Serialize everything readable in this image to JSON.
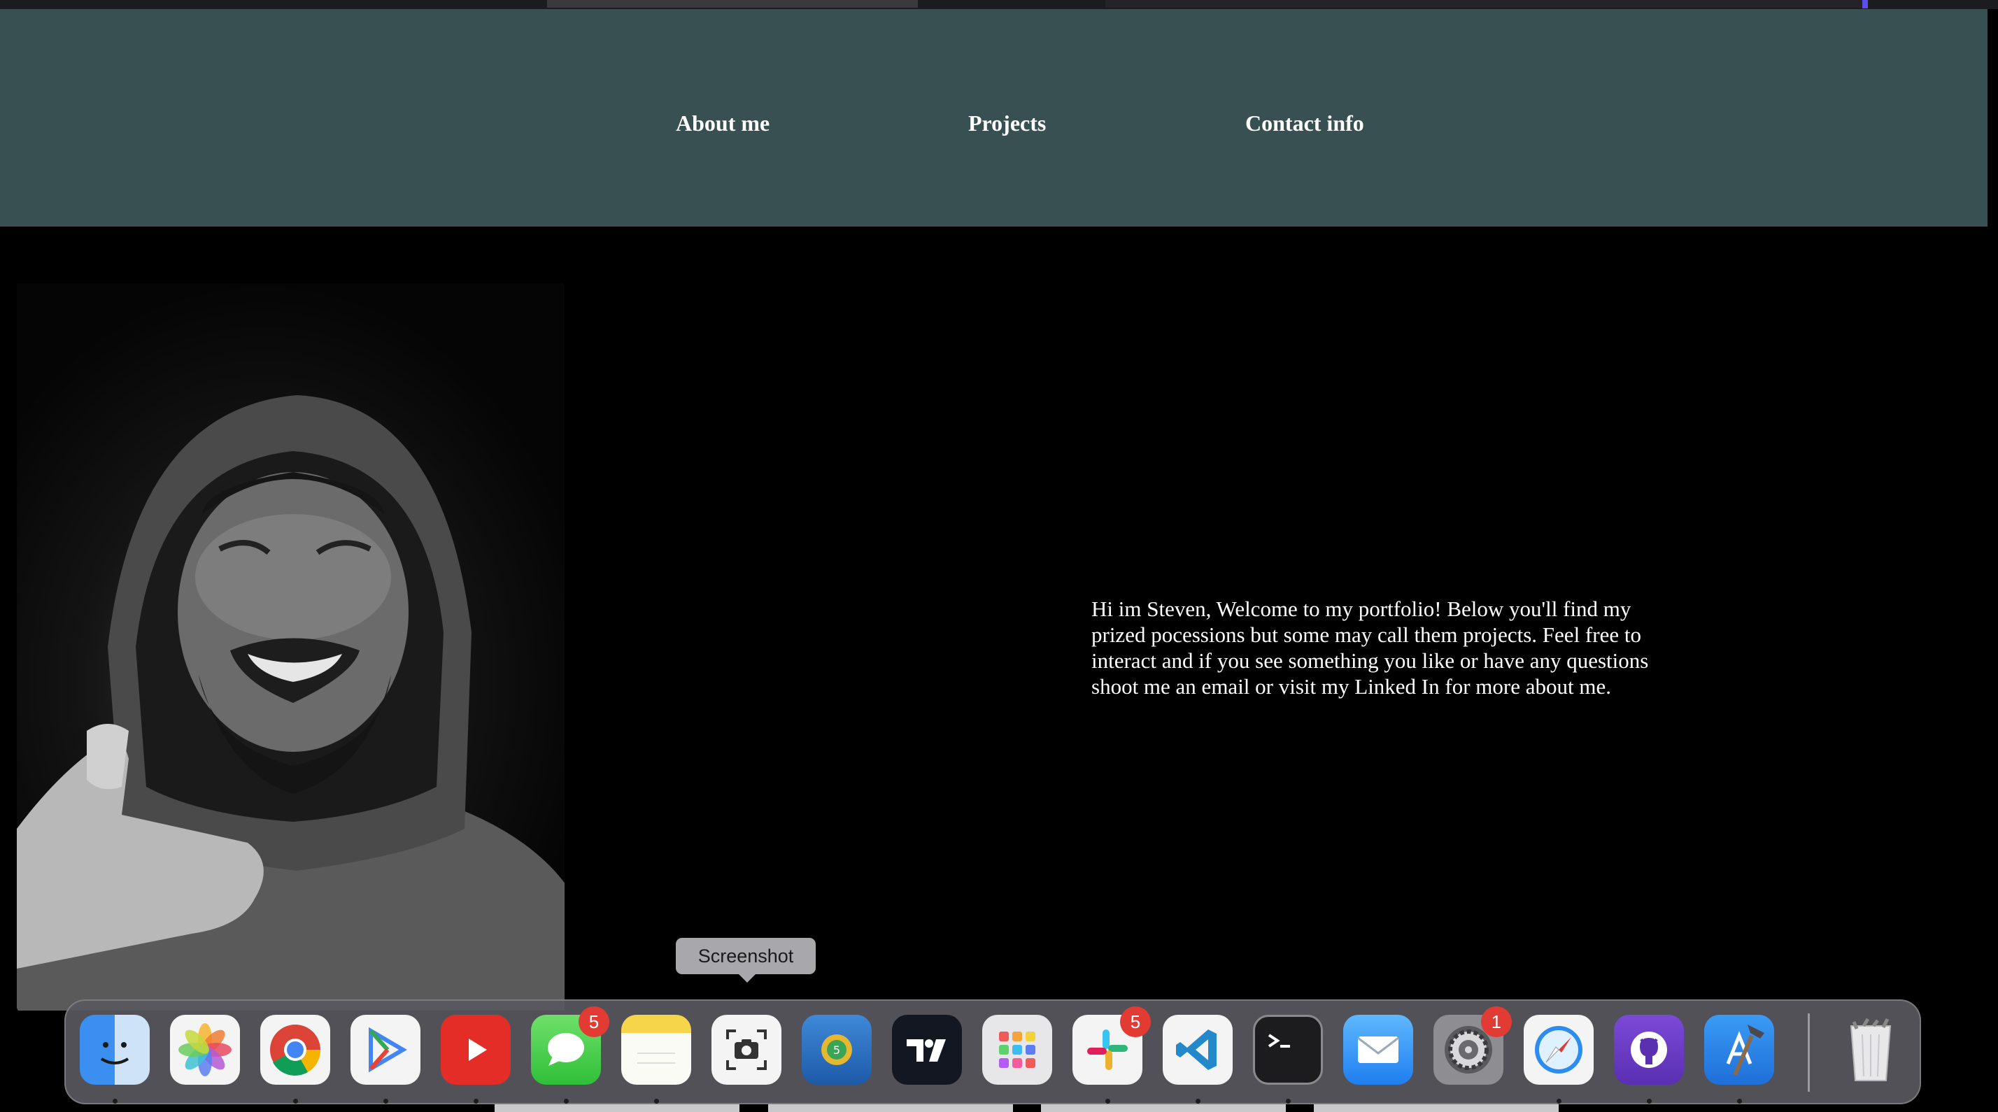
{
  "nav": {
    "about": "About me",
    "projects": "Projects",
    "contact": "Contact info"
  },
  "intro": {
    "text": "Hi im Steven, Welcome to my portfolio! Below you'll find my prized pocessions but some may call them projects. Feel free to interact and if you see something you like or have any questions shoot me an email or visit my Linked In for more about me."
  },
  "tooltip": {
    "label": "Screenshot"
  },
  "dock": {
    "badges": {
      "messages": "5",
      "slack": "5",
      "settings": "1"
    },
    "icons": [
      "finder-icon",
      "photos-icon",
      "chrome-icon",
      "play-icon",
      "youtube-icon",
      "messages-icon",
      "notes-icon",
      "screenshot-icon",
      "metatrader-icon",
      "tradingview-icon",
      "launchpad-icon",
      "slack-icon",
      "vscode-icon",
      "terminal-icon",
      "mail-icon",
      "settings-icon",
      "safari-icon",
      "github-icon",
      "xcode-icon",
      "trash-icon"
    ]
  },
  "colors": {
    "navbar": "#385052",
    "page_background": "#000000",
    "badge": "#e23b33"
  }
}
